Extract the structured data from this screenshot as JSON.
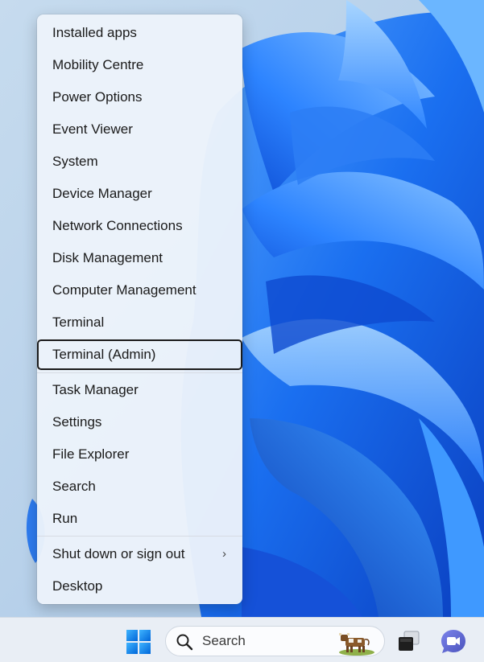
{
  "menu": {
    "items": [
      {
        "label": "Installed apps"
      },
      {
        "label": "Mobility Centre"
      },
      {
        "label": "Power Options"
      },
      {
        "label": "Event Viewer"
      },
      {
        "label": "System"
      },
      {
        "label": "Device Manager"
      },
      {
        "label": "Network Connections"
      },
      {
        "label": "Disk Management"
      },
      {
        "label": "Computer Management"
      },
      {
        "label": "Terminal"
      },
      {
        "label": "Terminal (Admin)",
        "focused": true
      },
      {
        "label": "Task Manager"
      },
      {
        "label": "Settings"
      },
      {
        "label": "File Explorer"
      },
      {
        "label": "Search"
      },
      {
        "label": "Run"
      },
      {
        "label": "Shut down or sign out",
        "has_submenu": true
      },
      {
        "label": "Desktop"
      }
    ],
    "submenu_chevron": "›"
  },
  "taskbar": {
    "search_label": "Search",
    "start_icon": "windows-logo-icon",
    "taskview_icon": "task-view-icon",
    "chat_icon": "chat-icon"
  },
  "colors": {
    "accent": "#0a6cd6",
    "wallpaper_base": "#b9d2ea",
    "menu_bg": "#ecf2fa",
    "focus_border": "#1b1b1b"
  }
}
